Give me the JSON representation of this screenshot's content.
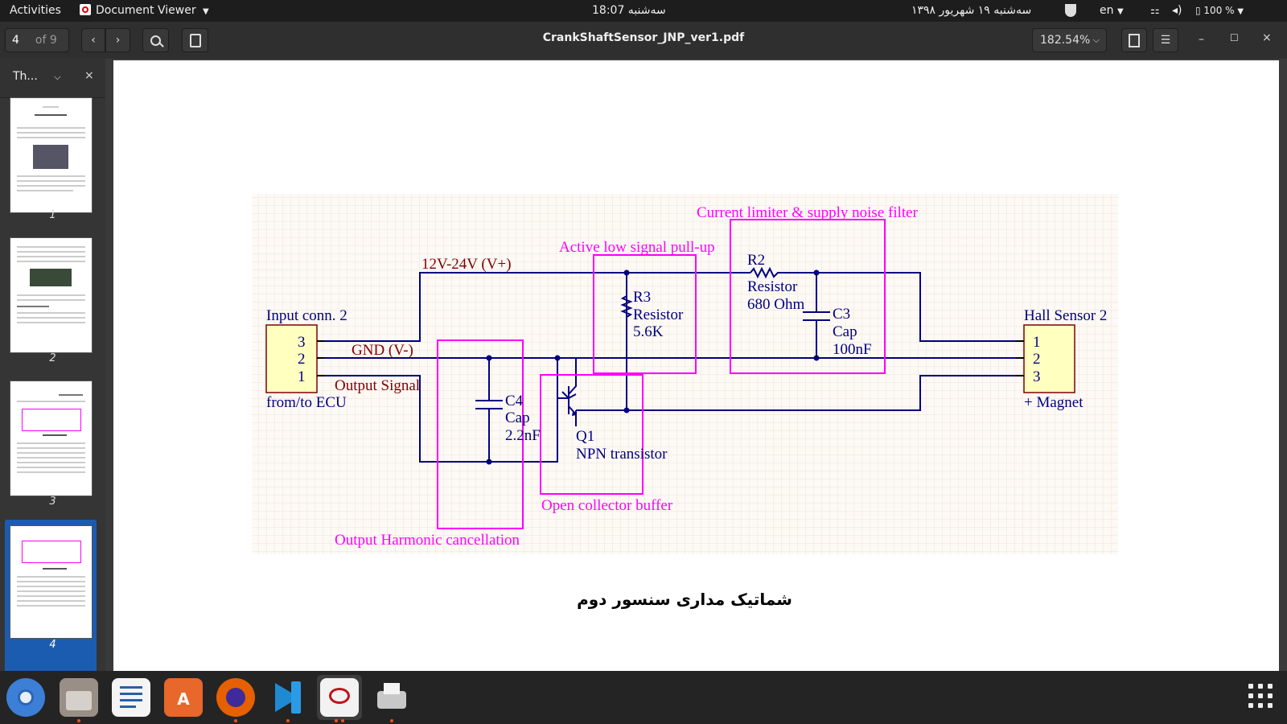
{
  "topbar": {
    "activities": "Activities",
    "app_menu": "Document Viewer",
    "clock": "سه‌شنبه 18:07",
    "date": "سه‌شنبه ۱۹ شهریور ۱۳۹۸",
    "lang": "en",
    "battery": "100 %"
  },
  "toolbar": {
    "page_current": "4",
    "page_total": "of 9",
    "doc_title": "CrankShaftSensor_JNP_ver1.pdf",
    "zoom": "182.54%"
  },
  "sidebar": {
    "view_label": "Th...",
    "close_label": "×",
    "thumbnails": [
      {
        "label": "1"
      },
      {
        "label": "2"
      },
      {
        "label": "3"
      },
      {
        "label": "4"
      }
    ]
  },
  "schematic": {
    "title_current_limiter": "Current limiter & supply noise filter",
    "title_pullup": "Active low signal pull-up",
    "title_buffer": "Open collector buffer",
    "title_harmonic": "Output Harmonic cancellation",
    "net_vplus": "12V-24V (V+)",
    "net_gnd": "GND (V-)",
    "net_output": "Output Signal",
    "conn_input_title": "Input conn. 2",
    "conn_input_sub": "from/to ECU",
    "conn_input_pins": [
      "3",
      "2",
      "1"
    ],
    "conn_hall_title": "Hall Sensor 2",
    "conn_hall_sub": "+ Magnet",
    "conn_hall_pins": [
      "1",
      "2",
      "3"
    ],
    "r2": [
      "R2",
      "Resistor",
      "680 Ohm"
    ],
    "r3": [
      "R3",
      "Resistor",
      "5.6K"
    ],
    "c3": [
      "C3",
      "Cap",
      "100nF"
    ],
    "c4": [
      "C4",
      "Cap",
      "2.2nF"
    ],
    "q1": [
      "Q1",
      "NPN transistor"
    ]
  },
  "caption": "شماتیک مداری سنسور دوم",
  "colors": {
    "wire": "#000080",
    "block": "#ff00ff",
    "net_label": "#800000",
    "connector_fill": "#ffffc0"
  }
}
